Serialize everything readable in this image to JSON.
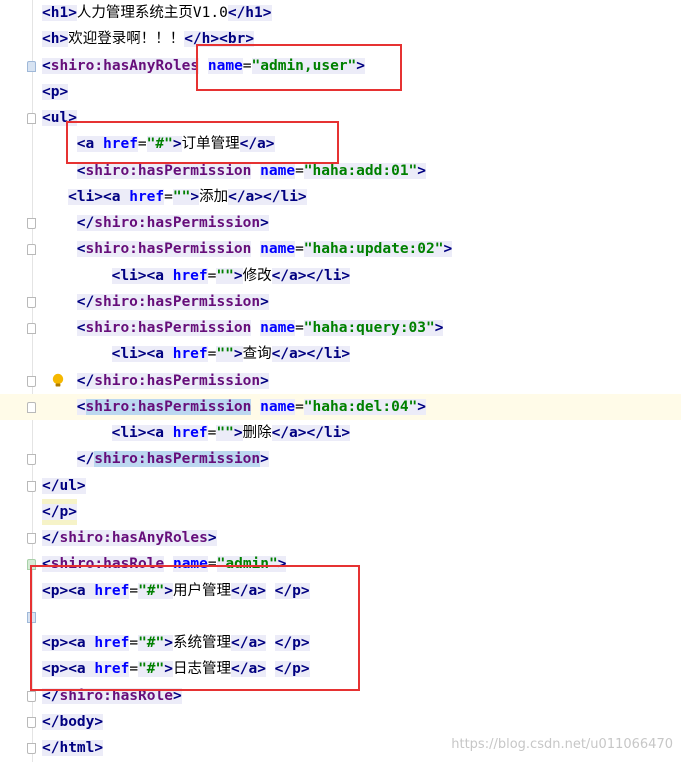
{
  "lines": [
    {
      "indent": 0,
      "fold": "none",
      "hl": false,
      "tokens": [
        [
          "tag",
          "<h1>"
        ],
        [
          "txt",
          "人力管理系统主页V1.0"
        ],
        [
          "tag",
          "</h1>"
        ]
      ]
    },
    {
      "indent": 0,
      "fold": "none",
      "hl": false,
      "tokens": [
        [
          "tag",
          "<h>"
        ],
        [
          "txt",
          "欢迎登录啊！！！"
        ],
        [
          "tag",
          "</h>"
        ],
        [
          "tag",
          "<br>"
        ]
      ]
    },
    {
      "indent": 0,
      "fold": "open-blue",
      "hl": false,
      "tokens": [
        [
          "tag",
          "<"
        ],
        [
          "ns",
          "shiro:hasAnyRoles"
        ],
        [
          "txt",
          " "
        ],
        [
          "attr",
          "name"
        ],
        [
          "txt",
          "="
        ],
        [
          "val",
          "\"admin,user\""
        ],
        [
          "tag",
          ">"
        ]
      ]
    },
    {
      "indent": 0,
      "fold": "none",
      "hl": false,
      "tokens": [
        [
          "tag",
          "<p>"
        ]
      ]
    },
    {
      "indent": 0,
      "fold": "open",
      "hl": false,
      "tokens": [
        [
          "tag",
          "<ul>"
        ]
      ]
    },
    {
      "indent": 4,
      "fold": "none",
      "hl": false,
      "tokens": [
        [
          "tag",
          "<a "
        ],
        [
          "attr",
          "href"
        ],
        [
          "txt",
          "="
        ],
        [
          "val",
          "\"#\""
        ],
        [
          "tag",
          ">"
        ],
        [
          "txt",
          "订单管理"
        ],
        [
          "tag",
          "</a>"
        ]
      ]
    },
    {
      "indent": 4,
      "fold": "none",
      "hl": false,
      "tokens": [
        [
          "tag",
          "<"
        ],
        [
          "ns",
          "shiro:hasPermission"
        ],
        [
          "txt",
          " "
        ],
        [
          "attr",
          "name"
        ],
        [
          "txt",
          "="
        ],
        [
          "val",
          "\"haha:add:01\""
        ],
        [
          "tag",
          ">"
        ]
      ]
    },
    {
      "indent": 3,
      "fold": "none",
      "hl": false,
      "tokens": [
        [
          "tag",
          "<li>"
        ],
        [
          "tag",
          "<a "
        ],
        [
          "attr",
          "href"
        ],
        [
          "txt",
          "="
        ],
        [
          "val",
          "\"\""
        ],
        [
          "tag",
          ">"
        ],
        [
          "txt",
          "添加"
        ],
        [
          "tag",
          "</a>"
        ],
        [
          "tag",
          "</li>"
        ]
      ]
    },
    {
      "indent": 4,
      "fold": "close",
      "hl": false,
      "tokens": [
        [
          "tag",
          "</"
        ],
        [
          "ns",
          "shiro:hasPermission"
        ],
        [
          "tag",
          ">"
        ]
      ]
    },
    {
      "indent": 4,
      "fold": "open",
      "hl": false,
      "tokens": [
        [
          "tag",
          "<"
        ],
        [
          "ns",
          "shiro:hasPermission"
        ],
        [
          "txt",
          " "
        ],
        [
          "attr",
          "name"
        ],
        [
          "txt",
          "="
        ],
        [
          "val",
          "\"haha:update:02\""
        ],
        [
          "tag",
          ">"
        ]
      ]
    },
    {
      "indent": 8,
      "fold": "none",
      "hl": false,
      "tokens": [
        [
          "tag",
          "<li>"
        ],
        [
          "tag",
          "<a "
        ],
        [
          "attr",
          "href"
        ],
        [
          "txt",
          "="
        ],
        [
          "val",
          "\"\""
        ],
        [
          "tag",
          ">"
        ],
        [
          "txt",
          "修改"
        ],
        [
          "tag",
          "</a>"
        ],
        [
          "tag",
          "</li>"
        ]
      ]
    },
    {
      "indent": 4,
      "fold": "close",
      "hl": false,
      "tokens": [
        [
          "tag",
          "</"
        ],
        [
          "ns",
          "shiro:hasPermission"
        ],
        [
          "tag",
          ">"
        ]
      ]
    },
    {
      "indent": 4,
      "fold": "open",
      "hl": false,
      "tokens": [
        [
          "tag",
          "<"
        ],
        [
          "ns",
          "shiro:hasPermission"
        ],
        [
          "txt",
          " "
        ],
        [
          "attr",
          "name"
        ],
        [
          "txt",
          "="
        ],
        [
          "val",
          "\"haha:query:03\""
        ],
        [
          "tag",
          ">"
        ]
      ]
    },
    {
      "indent": 8,
      "fold": "none",
      "hl": false,
      "tokens": [
        [
          "tag",
          "<li>"
        ],
        [
          "tag",
          "<a "
        ],
        [
          "attr",
          "href"
        ],
        [
          "txt",
          "="
        ],
        [
          "val",
          "\"\""
        ],
        [
          "tag",
          ">"
        ],
        [
          "txt",
          "查询"
        ],
        [
          "tag",
          "</a>"
        ],
        [
          "tag",
          "</li>"
        ]
      ]
    },
    {
      "indent": 4,
      "fold": "close",
      "hl": false,
      "bulb": true,
      "tokens": [
        [
          "tag",
          "</"
        ],
        [
          "ns",
          "shiro:hasPermission"
        ],
        [
          "tag",
          ">"
        ]
      ]
    },
    {
      "indent": 4,
      "fold": "open",
      "hl": true,
      "current": true,
      "tokens": [
        [
          "tag",
          "<"
        ],
        [
          "ns",
          "shiro:hasPermission"
        ],
        [
          "txt",
          " "
        ],
        [
          "attr",
          "name"
        ],
        [
          "txt",
          "="
        ],
        [
          "val",
          "\"haha:del:04\""
        ],
        [
          "tag",
          ">"
        ]
      ]
    },
    {
      "indent": 8,
      "fold": "none",
      "hl": false,
      "tokens": [
        [
          "tag",
          "<li>"
        ],
        [
          "tag",
          "<a "
        ],
        [
          "attr",
          "href"
        ],
        [
          "txt",
          "="
        ],
        [
          "val",
          "\"\""
        ],
        [
          "tag",
          ">"
        ],
        [
          "txt",
          "删除"
        ],
        [
          "tag",
          "</a>"
        ],
        [
          "tag",
          "</li>"
        ]
      ]
    },
    {
      "indent": 4,
      "fold": "close",
      "hl": true,
      "tokens": [
        [
          "tag",
          "</"
        ],
        [
          "ns",
          "shiro:hasPermission"
        ],
        [
          "tag",
          ">"
        ]
      ]
    },
    {
      "indent": 0,
      "fold": "close",
      "hl": false,
      "tokens": [
        [
          "tag",
          "</ul>"
        ]
      ]
    },
    {
      "indent": 0,
      "fold": "none",
      "hl": false,
      "yellow": true,
      "tokens": [
        [
          "tag",
          "</p>"
        ]
      ]
    },
    {
      "indent": 0,
      "fold": "close",
      "hl": false,
      "tokens": [
        [
          "tag",
          "</"
        ],
        [
          "ns",
          "shiro:hasAnyRoles"
        ],
        [
          "tag",
          ">"
        ]
      ]
    },
    {
      "indent": 0,
      "fold": "open-green",
      "hl": false,
      "tokens": [
        [
          "tag",
          "<"
        ],
        [
          "ns",
          "shiro:hasRole"
        ],
        [
          "txt",
          " "
        ],
        [
          "attr",
          "name"
        ],
        [
          "txt",
          "="
        ],
        [
          "val",
          "\"admin\""
        ],
        [
          "tag",
          ">"
        ]
      ]
    },
    {
      "indent": 0,
      "fold": "none",
      "hl": false,
      "tokens": [
        [
          "tag",
          "<p>"
        ],
        [
          "tag",
          "<a "
        ],
        [
          "attr",
          "href"
        ],
        [
          "txt",
          "="
        ],
        [
          "val",
          "\"#\""
        ],
        [
          "tag",
          ">"
        ],
        [
          "txt",
          "用户管理"
        ],
        [
          "tag",
          "</a>"
        ],
        [
          "txt",
          " "
        ],
        [
          "tag",
          "</p>"
        ]
      ]
    },
    {
      "indent": 0,
      "fold": "blue-mark",
      "hl": false,
      "tokens": []
    },
    {
      "indent": 0,
      "fold": "none",
      "hl": false,
      "tokens": [
        [
          "tag",
          "<p>"
        ],
        [
          "tag",
          "<a "
        ],
        [
          "attr",
          "href"
        ],
        [
          "txt",
          "="
        ],
        [
          "val",
          "\"#\""
        ],
        [
          "tag",
          ">"
        ],
        [
          "txt",
          "系统管理"
        ],
        [
          "tag",
          "</a>"
        ],
        [
          "txt",
          " "
        ],
        [
          "tag",
          "</p>"
        ]
      ]
    },
    {
      "indent": 0,
      "fold": "none",
      "hl": false,
      "tokens": [
        [
          "tag",
          "<p>"
        ],
        [
          "tag",
          "<a "
        ],
        [
          "attr",
          "href"
        ],
        [
          "txt",
          "="
        ],
        [
          "val",
          "\"#\""
        ],
        [
          "tag",
          ">"
        ],
        [
          "txt",
          "日志管理"
        ],
        [
          "tag",
          "</a>"
        ],
        [
          "txt",
          " "
        ],
        [
          "tag",
          "</p>"
        ]
      ]
    },
    {
      "indent": 0,
      "fold": "close",
      "hl": false,
      "tokens": [
        [
          "tag",
          "</"
        ],
        [
          "ns",
          "shiro:hasRole"
        ],
        [
          "tag",
          ">"
        ]
      ]
    },
    {
      "indent": 0,
      "fold": "close",
      "hl": false,
      "tokens": [
        [
          "tag",
          "</body>"
        ]
      ]
    },
    {
      "indent": 0,
      "fold": "close",
      "hl": false,
      "tokens": [
        [
          "tag",
          "</html>"
        ]
      ]
    }
  ],
  "watermark": "https://blog.csdn.net/u011066470",
  "colors": {
    "tag": "#000080",
    "namespace": "#660e7a",
    "attribute": "#0000ff",
    "value": "#008000",
    "annotation_box": "#e63232",
    "current_line": "#fffbe8"
  },
  "icons": {
    "intention_bulb": "lightbulb-icon",
    "fold_marker": "fold-marker-icon"
  }
}
